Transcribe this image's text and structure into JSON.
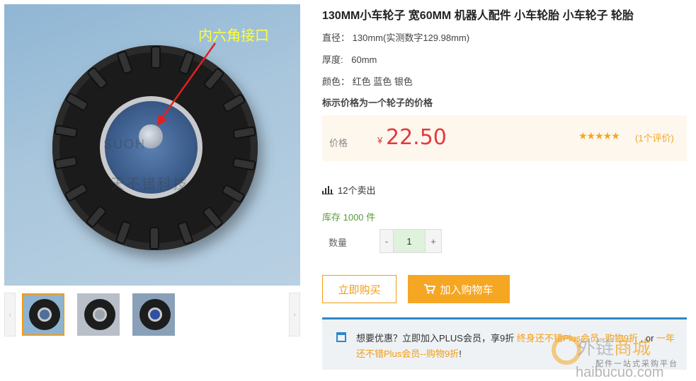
{
  "product": {
    "title": "130MM小车轮子 宽60MM 机器人配件 小车轮胎 小车轮子 轮胎",
    "specs": [
      {
        "label": "直径：",
        "value": "130mm(实测数字129.98mm)"
      },
      {
        "label": "厚度:",
        "value": "60mm"
      },
      {
        "label": "颜色：",
        "value": "红色 蓝色 银色"
      }
    ],
    "notice": "标示价格为一个轮子的价格",
    "image_callout": "内六角接口",
    "image_watermark_1": "SUOH",
    "image_watermark_2": "天不错科技"
  },
  "price": {
    "label": "价格",
    "currency": "¥",
    "value": "22.50",
    "stars": "★★★★★",
    "reviews": "(1个评价)"
  },
  "sales": {
    "sold": "12个卖出",
    "stock": "库存 1000 件"
  },
  "quantity": {
    "label": "数量",
    "minus": "-",
    "value": "1",
    "plus": "+"
  },
  "actions": {
    "buy_now": "立即购买",
    "add_to_cart": "加入购物车",
    "cart_icon": "shopping-cart-icon"
  },
  "plus_member": {
    "text_before": "想要优惠？立即加入PLUS会员，享9折 ",
    "link_1": "终身还不错Plus会员--购物9折",
    "text_middle": " , or ",
    "link_2": "一年还不错Plus会员--购物9折",
    "text_after": "!"
  },
  "gallery": {
    "prev": "‹",
    "next": "›",
    "thumbnails": [
      "thumb-1",
      "thumb-2",
      "thumb-3"
    ]
  },
  "site_watermark": {
    "name_gray": "外链",
    "name_orange": "商城",
    "slogan": "配件一站式采购平台",
    "url": "haibucuo.com"
  },
  "colors": {
    "accent": "#f39c12",
    "price_red": "#e4393c",
    "plus_blue": "#2d88c7",
    "stock_green": "#5a9a3e"
  }
}
